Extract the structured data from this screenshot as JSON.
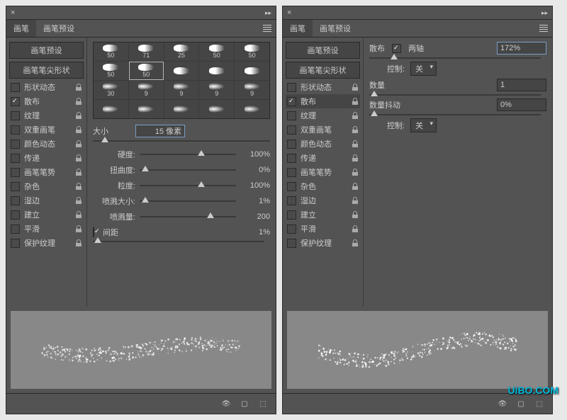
{
  "tabs": {
    "brush": "画笔",
    "preset": "画笔预设"
  },
  "sidebar": {
    "preset_btn": "画笔预设",
    "tip_shape": "画笔笔尖形状",
    "items": [
      {
        "label": "形状动态",
        "checked": false
      },
      {
        "label": "散布",
        "checked": true
      },
      {
        "label": "纹理",
        "checked": false
      },
      {
        "label": "双重画笔",
        "checked": false
      },
      {
        "label": "颜色动态",
        "checked": false
      },
      {
        "label": "传递",
        "checked": false
      },
      {
        "label": "画笔笔势",
        "checked": false
      },
      {
        "label": "杂色",
        "checked": false
      },
      {
        "label": "湿边",
        "checked": false
      },
      {
        "label": "建立",
        "checked": false
      },
      {
        "label": "平滑",
        "checked": false
      },
      {
        "label": "保护纹理",
        "checked": false
      }
    ]
  },
  "brush_sizes": [
    [
      "50",
      "71",
      "25",
      "50",
      "50"
    ],
    [
      "50",
      "50",
      "",
      "",
      ""
    ],
    [
      "30",
      "9",
      "9",
      "9",
      "9"
    ],
    [
      "",
      "",
      "",
      "",
      ""
    ]
  ],
  "left": {
    "size_label": "大小",
    "size_value": "15 像素",
    "sliders": [
      {
        "label": "硬度:",
        "val": "100%",
        "pos": 60
      },
      {
        "label": "扭曲度:",
        "val": "0%",
        "pos": 2
      },
      {
        "label": "粒度:",
        "val": "100%",
        "pos": 60
      },
      {
        "label": "喷溅大小:",
        "val": "1%",
        "pos": 2
      },
      {
        "label": "喷溅量:",
        "val": "200",
        "pos": 70
      }
    ],
    "spacing_label": "间距",
    "spacing_val": "1%"
  },
  "right": {
    "scatter_label": "散布",
    "both_axes": "两轴",
    "scatter_val": "172%",
    "control_label": "控制:",
    "control_val": "关",
    "count_label": "数量",
    "count_val": "1",
    "jitter_label": "数量抖动",
    "jitter_val": "0%"
  },
  "watermark": "UiBO.COM"
}
